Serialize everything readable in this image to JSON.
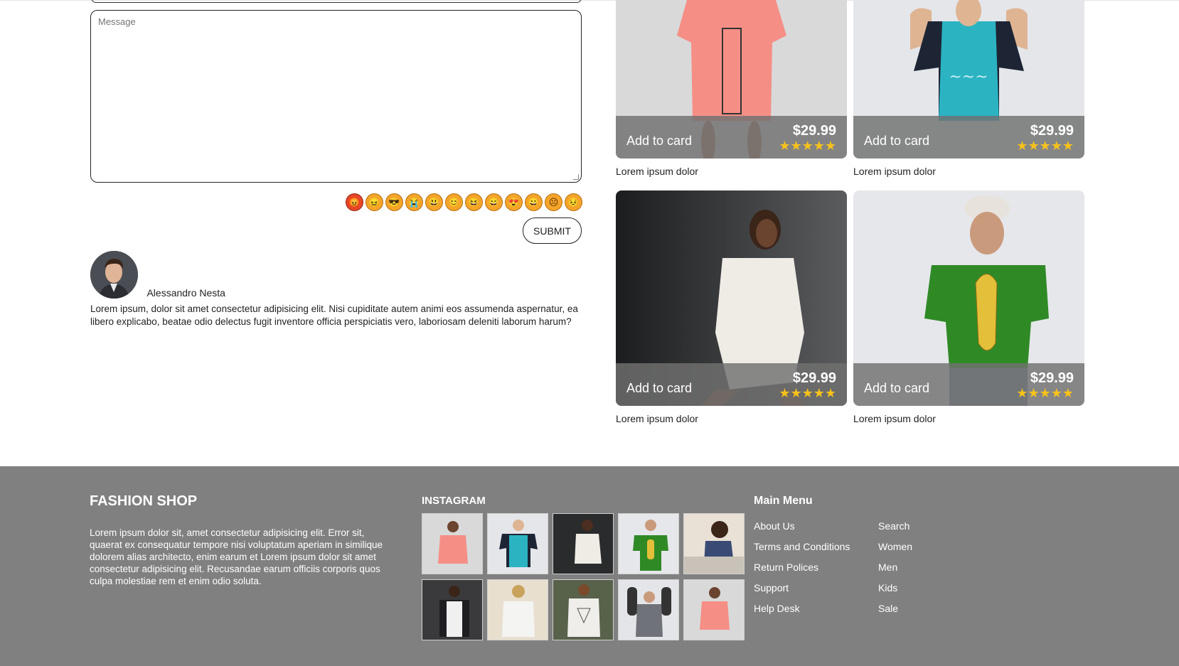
{
  "form": {
    "message_placeholder": "Message",
    "submit_label": "SUBMIT",
    "emojis": [
      "😡",
      "😖",
      "😎",
      "😭",
      "😃",
      "😊",
      "😆",
      "😄",
      "😍",
      "😀",
      "☹",
      "😣"
    ]
  },
  "comment": {
    "author": "Alessandro Nesta",
    "text": "Lorem ipsum, dolor sit amet consectetur adipisicing elit. Nisi cupiditate autem animi eos assumenda aspernatur, ea libero explicabo, beatae odio delectus fugit inventore officia perspiciatis vero, laboriosam deleniti laborum harum?"
  },
  "products": [
    {
      "add_label": "Add to card",
      "price": "$29.99",
      "stars": "★★★★★",
      "rating": 5,
      "caption": "Lorem ipsum dolor",
      "shirt_color": "#f58f86"
    },
    {
      "add_label": "Add to card",
      "price": "$29.99",
      "stars": "★★★★★",
      "rating": 5,
      "caption": "Lorem ipsum dolor",
      "shirt_color": "#2bb3c2"
    },
    {
      "add_label": "Add to card",
      "price": "$29.99",
      "stars": "★★★★★",
      "rating": 5,
      "caption": "Lorem ipsum dolor",
      "shirt_color": "#efece6"
    },
    {
      "add_label": "Add to card",
      "price": "$29.99",
      "stars": "★★★★★",
      "rating": 5,
      "caption": "Lorem ipsum dolor",
      "shirt_color": "#2f8a26"
    }
  ],
  "footer": {
    "brand_title": "FASHION SHOP",
    "brand_text": "Lorem ipsum dolor sit, amet consectetur adipisicing elit. Error sit, quaerat ex consequatur tempore nisi voluptatum aperiam in similique dolorem alias architecto, enim earum et Lorem ipsum dolor sit amet consectetur adipisicing elit. Recusandae earum officiis corporis quos culpa molestiae rem et enim odio soluta.",
    "instagram_title": "INSTAGRAM",
    "menu_title": "Main Menu",
    "menu_left": [
      "About Us",
      "Terms and Conditions",
      "Return Polices",
      "Support",
      "Help Desk"
    ],
    "menu_right": [
      "Search",
      "Women",
      "Men",
      "Kids",
      "Sale"
    ]
  },
  "colors": {
    "footer_bg": "#808080",
    "star": "#f7c21b",
    "price_bar": "#707070"
  }
}
